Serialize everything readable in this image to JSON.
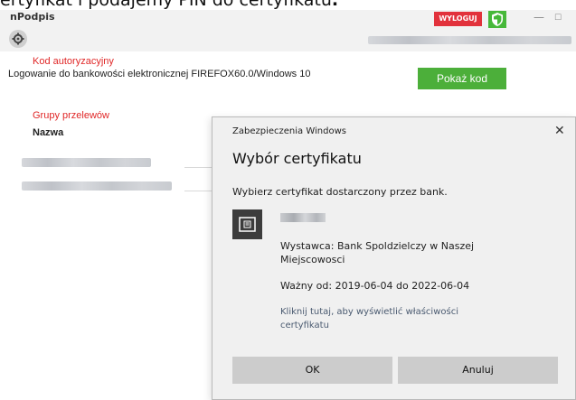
{
  "caption": {
    "text_before": "ertyfikat i podajemy PIN do certyfikatu",
    "text_bold": "."
  },
  "titlebar": {
    "app_title": "nPodpis",
    "logout_label": "WYLOGUJ",
    "minimize_glyph": "—",
    "maximize_glyph": "☐",
    "logout_color": "#e2323c",
    "shield_color": "#47b83a"
  },
  "toolbar": {
    "settings_icon": "gear-icon"
  },
  "auth": {
    "label": "Kod autoryzacyjny",
    "description": "Logowanie do bankowości elektronicznej FIREFOX60.0/Windows 10",
    "show_code_label": "Pokaż kod",
    "button_color": "#4caf3a"
  },
  "groups": {
    "label": "Grupy przelewów",
    "column_header": "Nazwa"
  },
  "dialog": {
    "caption": "Zabezpieczenia Windows",
    "close_glyph": "✕",
    "title": "Wybór certyfikatu",
    "subtitle": "Wybierz certyfikat dostarczony przez bank.",
    "issuer_line1": "Wystawca: Bank Spoldzielczy w Naszej",
    "issuer_line2": "Miejscowosci",
    "validity": "Ważny od: 2019-06-04 do 2022-06-04",
    "link_line1": "Kliknij tutaj, aby wyświetlić właściwości",
    "link_line2": "certyfikatu",
    "ok_label": "OK",
    "cancel_label": "Anuluj"
  }
}
